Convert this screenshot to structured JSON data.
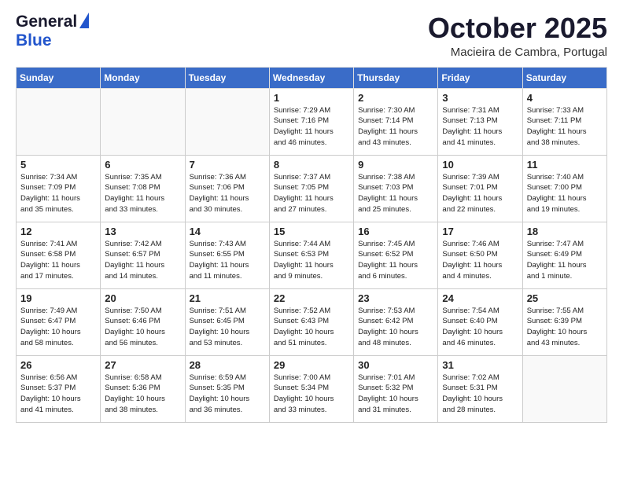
{
  "header": {
    "logo_general": "General",
    "logo_blue": "Blue",
    "month": "October 2025",
    "location": "Macieira de Cambra, Portugal"
  },
  "days_of_week": [
    "Sunday",
    "Monday",
    "Tuesday",
    "Wednesday",
    "Thursday",
    "Friday",
    "Saturday"
  ],
  "weeks": [
    [
      {
        "day": "",
        "info": ""
      },
      {
        "day": "",
        "info": ""
      },
      {
        "day": "",
        "info": ""
      },
      {
        "day": "1",
        "info": "Sunrise: 7:29 AM\nSunset: 7:16 PM\nDaylight: 11 hours\nand 46 minutes."
      },
      {
        "day": "2",
        "info": "Sunrise: 7:30 AM\nSunset: 7:14 PM\nDaylight: 11 hours\nand 43 minutes."
      },
      {
        "day": "3",
        "info": "Sunrise: 7:31 AM\nSunset: 7:13 PM\nDaylight: 11 hours\nand 41 minutes."
      },
      {
        "day": "4",
        "info": "Sunrise: 7:33 AM\nSunset: 7:11 PM\nDaylight: 11 hours\nand 38 minutes."
      }
    ],
    [
      {
        "day": "5",
        "info": "Sunrise: 7:34 AM\nSunset: 7:09 PM\nDaylight: 11 hours\nand 35 minutes."
      },
      {
        "day": "6",
        "info": "Sunrise: 7:35 AM\nSunset: 7:08 PM\nDaylight: 11 hours\nand 33 minutes."
      },
      {
        "day": "7",
        "info": "Sunrise: 7:36 AM\nSunset: 7:06 PM\nDaylight: 11 hours\nand 30 minutes."
      },
      {
        "day": "8",
        "info": "Sunrise: 7:37 AM\nSunset: 7:05 PM\nDaylight: 11 hours\nand 27 minutes."
      },
      {
        "day": "9",
        "info": "Sunrise: 7:38 AM\nSunset: 7:03 PM\nDaylight: 11 hours\nand 25 minutes."
      },
      {
        "day": "10",
        "info": "Sunrise: 7:39 AM\nSunset: 7:01 PM\nDaylight: 11 hours\nand 22 minutes."
      },
      {
        "day": "11",
        "info": "Sunrise: 7:40 AM\nSunset: 7:00 PM\nDaylight: 11 hours\nand 19 minutes."
      }
    ],
    [
      {
        "day": "12",
        "info": "Sunrise: 7:41 AM\nSunset: 6:58 PM\nDaylight: 11 hours\nand 17 minutes."
      },
      {
        "day": "13",
        "info": "Sunrise: 7:42 AM\nSunset: 6:57 PM\nDaylight: 11 hours\nand 14 minutes."
      },
      {
        "day": "14",
        "info": "Sunrise: 7:43 AM\nSunset: 6:55 PM\nDaylight: 11 hours\nand 11 minutes."
      },
      {
        "day": "15",
        "info": "Sunrise: 7:44 AM\nSunset: 6:53 PM\nDaylight: 11 hours\nand 9 minutes."
      },
      {
        "day": "16",
        "info": "Sunrise: 7:45 AM\nSunset: 6:52 PM\nDaylight: 11 hours\nand 6 minutes."
      },
      {
        "day": "17",
        "info": "Sunrise: 7:46 AM\nSunset: 6:50 PM\nDaylight: 11 hours\nand 4 minutes."
      },
      {
        "day": "18",
        "info": "Sunrise: 7:47 AM\nSunset: 6:49 PM\nDaylight: 11 hours\nand 1 minute."
      }
    ],
    [
      {
        "day": "19",
        "info": "Sunrise: 7:49 AM\nSunset: 6:47 PM\nDaylight: 10 hours\nand 58 minutes."
      },
      {
        "day": "20",
        "info": "Sunrise: 7:50 AM\nSunset: 6:46 PM\nDaylight: 10 hours\nand 56 minutes."
      },
      {
        "day": "21",
        "info": "Sunrise: 7:51 AM\nSunset: 6:45 PM\nDaylight: 10 hours\nand 53 minutes."
      },
      {
        "day": "22",
        "info": "Sunrise: 7:52 AM\nSunset: 6:43 PM\nDaylight: 10 hours\nand 51 minutes."
      },
      {
        "day": "23",
        "info": "Sunrise: 7:53 AM\nSunset: 6:42 PM\nDaylight: 10 hours\nand 48 minutes."
      },
      {
        "day": "24",
        "info": "Sunrise: 7:54 AM\nSunset: 6:40 PM\nDaylight: 10 hours\nand 46 minutes."
      },
      {
        "day": "25",
        "info": "Sunrise: 7:55 AM\nSunset: 6:39 PM\nDaylight: 10 hours\nand 43 minutes."
      }
    ],
    [
      {
        "day": "26",
        "info": "Sunrise: 6:56 AM\nSunset: 5:37 PM\nDaylight: 10 hours\nand 41 minutes."
      },
      {
        "day": "27",
        "info": "Sunrise: 6:58 AM\nSunset: 5:36 PM\nDaylight: 10 hours\nand 38 minutes."
      },
      {
        "day": "28",
        "info": "Sunrise: 6:59 AM\nSunset: 5:35 PM\nDaylight: 10 hours\nand 36 minutes."
      },
      {
        "day": "29",
        "info": "Sunrise: 7:00 AM\nSunset: 5:34 PM\nDaylight: 10 hours\nand 33 minutes."
      },
      {
        "day": "30",
        "info": "Sunrise: 7:01 AM\nSunset: 5:32 PM\nDaylight: 10 hours\nand 31 minutes."
      },
      {
        "day": "31",
        "info": "Sunrise: 7:02 AM\nSunset: 5:31 PM\nDaylight: 10 hours\nand 28 minutes."
      },
      {
        "day": "",
        "info": ""
      }
    ]
  ]
}
